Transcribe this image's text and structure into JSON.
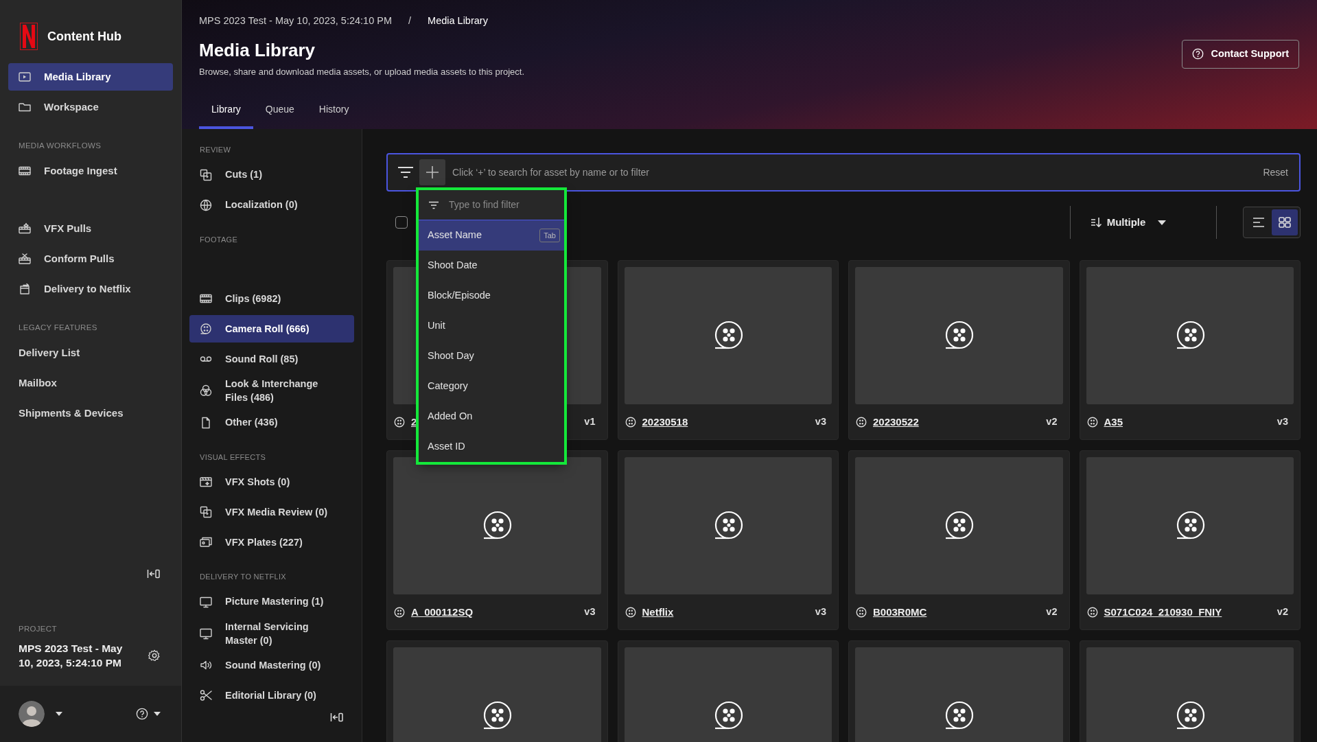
{
  "brand": {
    "title": "Content Hub"
  },
  "nav": {
    "items": [
      {
        "label": "Media Library",
        "selected": true
      },
      {
        "label": "Workspace",
        "selected": false
      }
    ],
    "sections": [
      {
        "heading": "MEDIA WORKFLOWS",
        "items": [
          {
            "label": "Footage Ingest",
            "selected": false
          },
          {
            "label": "VFX Pulls",
            "selected": false
          },
          {
            "label": "Conform Pulls",
            "selected": false
          },
          {
            "label": "Delivery to Netflix",
            "selected": false
          }
        ]
      },
      {
        "heading": "LEGACY FEATURES",
        "items": [
          {
            "label": "Delivery List",
            "selected": false
          },
          {
            "label": "Mailbox",
            "selected": false
          },
          {
            "label": "Shipments & Devices",
            "selected": false
          }
        ]
      }
    ],
    "project": {
      "heading": "PROJECT",
      "name": "MPS 2023 Test - May 10, 2023, 5:24:10 PM"
    }
  },
  "header": {
    "breadcrumb": [
      "MPS 2023 Test - May 10, 2023, 5:24:10 PM",
      "Media Library"
    ],
    "separator": "/",
    "title": "Media Library",
    "subtitle": "Browse, share and download media assets, or upload media assets to this project.",
    "support_button": "Contact Support",
    "tabs": [
      {
        "label": "Library",
        "selected": true
      },
      {
        "label": "Queue",
        "selected": false
      },
      {
        "label": "History",
        "selected": false
      }
    ]
  },
  "categories": [
    {
      "heading": "REVIEW",
      "items": [
        {
          "label": "Cuts (1)",
          "selected": false
        },
        {
          "label": "Localization (0)",
          "selected": false
        }
      ]
    },
    {
      "heading": "FOOTAGE",
      "items": [
        {
          "label": "Clips (6982)",
          "selected": false
        },
        {
          "label": "Camera Roll (666)",
          "selected": true
        },
        {
          "label": "Sound Roll (85)",
          "selected": false
        },
        {
          "label": "Look & Interchange Files (486)",
          "selected": false
        },
        {
          "label": "Other (436)",
          "selected": false
        }
      ]
    },
    {
      "heading": "VISUAL EFFECTS",
      "items": [
        {
          "label": "VFX Shots (0)",
          "selected": false
        },
        {
          "label": "VFX Media Review (0)",
          "selected": false
        },
        {
          "label": "VFX Plates (227)",
          "selected": false
        }
      ]
    },
    {
      "heading": "DELIVERY TO NETFLIX",
      "items": [
        {
          "label": "Picture Mastering (1)",
          "selected": false
        },
        {
          "label": "Internal Servicing Master (0)",
          "selected": false
        },
        {
          "label": "Sound Mastering (0)",
          "selected": false
        },
        {
          "label": "Editorial Library (0)",
          "selected": false
        }
      ]
    }
  ],
  "search": {
    "placeholder": "Click ‘+’ to search for asset by name or to filter",
    "reset": "Reset"
  },
  "filter_menu": {
    "placeholder": "Type to find filter",
    "items": [
      {
        "label": "Asset Name",
        "selected": true,
        "hint": "Tab"
      },
      {
        "label": "Shoot Date",
        "selected": false
      },
      {
        "label": "Block/Episode",
        "selected": false
      },
      {
        "label": "Unit",
        "selected": false
      },
      {
        "label": "Shoot Day",
        "selected": false
      },
      {
        "label": "Category",
        "selected": false
      },
      {
        "label": "Added On",
        "selected": false
      },
      {
        "label": "Asset ID",
        "selected": false
      }
    ]
  },
  "toolbar": {
    "select_all": {
      "checked": false
    },
    "sort": "Multiple",
    "views": [
      {
        "kind": "list",
        "selected": false
      },
      {
        "kind": "grid",
        "selected": true
      }
    ]
  },
  "assets": [
    {
      "kind": "full",
      "name": "2",
      "version": "v1"
    },
    {
      "kind": "full",
      "name": "20230518",
      "version": "v3"
    },
    {
      "kind": "full",
      "name": "20230522",
      "version": "v2"
    },
    {
      "kind": "full",
      "name": "A35",
      "version": "v3"
    },
    {
      "kind": "full",
      "name": "A_000112SQ",
      "version": "v3"
    },
    {
      "kind": "full",
      "name": "Netflix",
      "version": "v3"
    },
    {
      "kind": "full",
      "name": "B003R0MC",
      "version": "v2"
    },
    {
      "kind": "full",
      "name": "S071C024_210930_FNIY",
      "version": "v2"
    },
    {
      "kind": "partial"
    },
    {
      "kind": "partial"
    },
    {
      "kind": "partial"
    },
    {
      "kind": "partial"
    }
  ]
}
